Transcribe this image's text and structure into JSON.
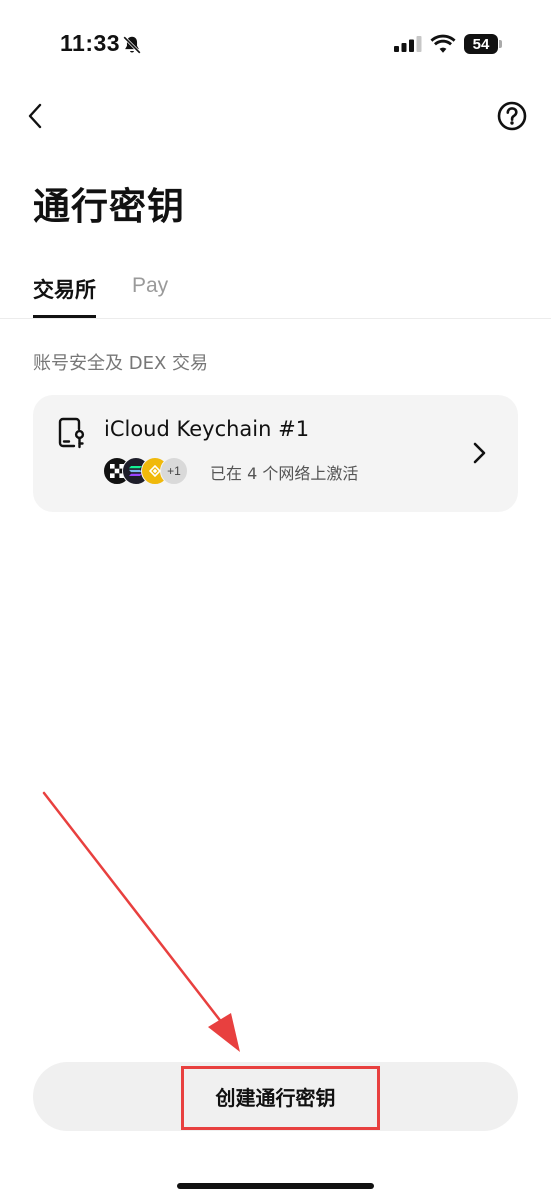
{
  "status_bar": {
    "time": "11:33",
    "battery": "54"
  },
  "header": {
    "title": "通行密钥"
  },
  "tabs": [
    {
      "label": "交易所",
      "active": true
    },
    {
      "label": "Pay",
      "active": false
    }
  ],
  "section": {
    "label": "账号安全及 DEX 交易"
  },
  "passkey": {
    "name": "iCloud Keychain #1",
    "networks": [
      "okx-icon",
      "solana-icon",
      "bnb-icon"
    ],
    "more_networks": "+1",
    "status": "已在 4 个网络上激活"
  },
  "actions": {
    "create_label": "创建通行密钥"
  },
  "colors": {
    "annotation": "#e8403f",
    "card_bg": "#f4f4f4",
    "button_bg": "#f0f0f0"
  }
}
